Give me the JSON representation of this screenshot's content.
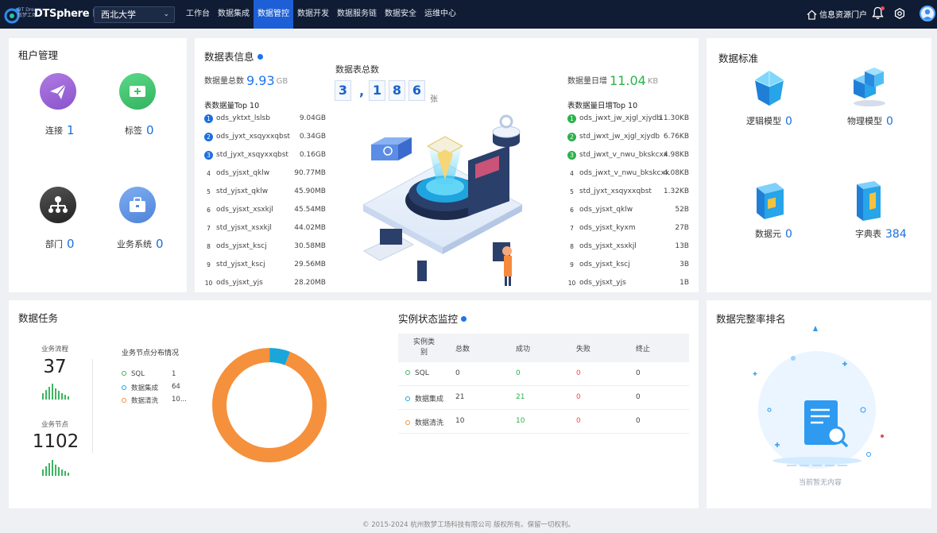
{
  "header": {
    "logo_small": "数梦工场",
    "logo_tag": "DT Dream",
    "product": "DTSphere DSC",
    "org_select": "西北大学",
    "nav": [
      {
        "label": "工作台"
      },
      {
        "label": "数据集成"
      },
      {
        "label": "数据管控",
        "active": true
      },
      {
        "label": "数据开发"
      },
      {
        "label": "数据服务链"
      },
      {
        "label": "数据安全"
      },
      {
        "label": "运维中心"
      }
    ],
    "portal": "信息资源门户",
    "icons": [
      "home-icon",
      "bell-icon",
      "settings-icon",
      "user-avatar-icon"
    ]
  },
  "tenant": {
    "title": "租户管理",
    "items": [
      {
        "label": "连接",
        "count": "1",
        "icon": "send-icon",
        "color": "#9b66d6"
      },
      {
        "label": "标签",
        "count": "0",
        "icon": "tag-icon",
        "color": "#3dc46a"
      },
      {
        "label": "部门",
        "count": "0",
        "icon": "org-tree-icon",
        "color": "#3a3a3a"
      },
      {
        "label": "业务系统",
        "count": "0",
        "icon": "briefcase-icon",
        "color": "#5a8fe0"
      }
    ]
  },
  "table_info": {
    "title": "数据表信息",
    "total_size_label": "数据量总数",
    "total_size_value": "9.93",
    "total_size_unit": "GB",
    "top_title": "表数据量Top 10",
    "top": [
      {
        "rank": "1",
        "name": "ods_yktxt_lslsb",
        "value": "9.04GB"
      },
      {
        "rank": "2",
        "name": "ods_jyxt_xsqyxxqbst",
        "value": "0.34GB"
      },
      {
        "rank": "3",
        "name": "std_jyxt_xsqyxxqbst",
        "value": "0.16GB"
      },
      {
        "rank": "4",
        "name": "ods_yjsxt_qklw",
        "value": "90.77MB"
      },
      {
        "rank": "5",
        "name": "std_yjsxt_qklw",
        "value": "45.90MB"
      },
      {
        "rank": "6",
        "name": "ods_yjsxt_xsxkjl",
        "value": "45.54MB"
      },
      {
        "rank": "7",
        "name": "std_yjsxt_xsxkjl",
        "value": "44.02MB"
      },
      {
        "rank": "8",
        "name": "ods_yjsxt_kscj",
        "value": "30.58MB"
      },
      {
        "rank": "9",
        "name": "std_yjsxt_kscj",
        "value": "29.56MB"
      },
      {
        "rank": "10",
        "name": "ods_yjsxt_yjs",
        "value": "28.20MB"
      }
    ],
    "total_tables_label": "数据表总数",
    "total_tables_digits": [
      "3",
      ",",
      "1",
      "8",
      "6"
    ],
    "total_tables_unit": "张",
    "daily_label": "数据量日增",
    "daily_value": "11.04",
    "daily_unit": "KB",
    "daily_top_title": "表数据量日增Top 10",
    "daily_top": [
      {
        "rank": "1",
        "name": "ods_jwxt_jw_xjgl_xjydb",
        "value": "11.30KB"
      },
      {
        "rank": "2",
        "name": "std_jwxt_jw_xjgl_xjydb",
        "value": "6.76KB"
      },
      {
        "rank": "3",
        "name": "std_jwxt_v_nwu_bkskcxx",
        "value": "4.98KB"
      },
      {
        "rank": "4",
        "name": "ods_jwxt_v_nwu_bkskcxx",
        "value": "4.08KB"
      },
      {
        "rank": "5",
        "name": "std_jyxt_xsqyxxqbst",
        "value": "1.32KB"
      },
      {
        "rank": "6",
        "name": "ods_yjsxt_qklw",
        "value": "52B"
      },
      {
        "rank": "7",
        "name": "ods_yjsxt_kyxm",
        "value": "27B"
      },
      {
        "rank": "8",
        "name": "ods_yjsxt_xsxkjl",
        "value": "13B"
      },
      {
        "rank": "9",
        "name": "ods_yjsxt_kscj",
        "value": "3B"
      },
      {
        "rank": "10",
        "name": "ods_yjsxt_yjs",
        "value": "1B"
      }
    ]
  },
  "standards": {
    "title": "数据标准",
    "items": [
      {
        "label": "逻辑模型",
        "count": "0",
        "icon": "crystal-model-icon"
      },
      {
        "label": "物理模型",
        "count": "0",
        "icon": "cubes-model-icon"
      },
      {
        "label": "数据元",
        "count": "0",
        "icon": "data-element-book-icon"
      },
      {
        "label": "字典表",
        "count": "384",
        "icon": "dictionary-book-icon"
      }
    ]
  },
  "tasks": {
    "title": "数据任务",
    "flow_label": "业务流程",
    "flow_value": "37",
    "node_label": "业务节点",
    "node_value": "1102",
    "dist_title": "业务节点分布情况",
    "legend": [
      {
        "label": "SQL",
        "value": "1",
        "color": "#3cb55f"
      },
      {
        "label": "数据集成",
        "value": "64",
        "color": "#1aa6d9"
      },
      {
        "label": "数据清洗",
        "value": "10...",
        "color": "#f5903d"
      }
    ]
  },
  "monitor": {
    "title": "实例状态监控",
    "headers": {
      "type_line1": "实例类",
      "type_line2": "别",
      "total": "总数",
      "success": "成功",
      "fail": "失败",
      "stop": "终止"
    },
    "rows": [
      {
        "type": "SQL",
        "total": "0",
        "success": "0",
        "fail": "0",
        "stop": "0",
        "color": "#3cb55f"
      },
      {
        "type": "数据集成",
        "total": "21",
        "success": "21",
        "fail": "0",
        "stop": "0",
        "color": "#1aa6d9"
      },
      {
        "type": "数据清洗",
        "total": "10",
        "success": "10",
        "fail": "0",
        "stop": "0",
        "color": "#f5903d"
      }
    ]
  },
  "completeness": {
    "title": "数据完整率排名",
    "empty_text": "当前暂无内容"
  },
  "chart_data": {
    "type": "pie",
    "style": "donut",
    "categories": [
      "SQL",
      "数据集成",
      "数据清洗"
    ],
    "values": [
      1,
      64,
      1037
    ],
    "colors": [
      "#3cb55f",
      "#1aa6d9",
      "#f5903d"
    ]
  },
  "footer": "© 2015-2024 杭州数梦工场科技有限公司 版权所有。保留一切权利。"
}
